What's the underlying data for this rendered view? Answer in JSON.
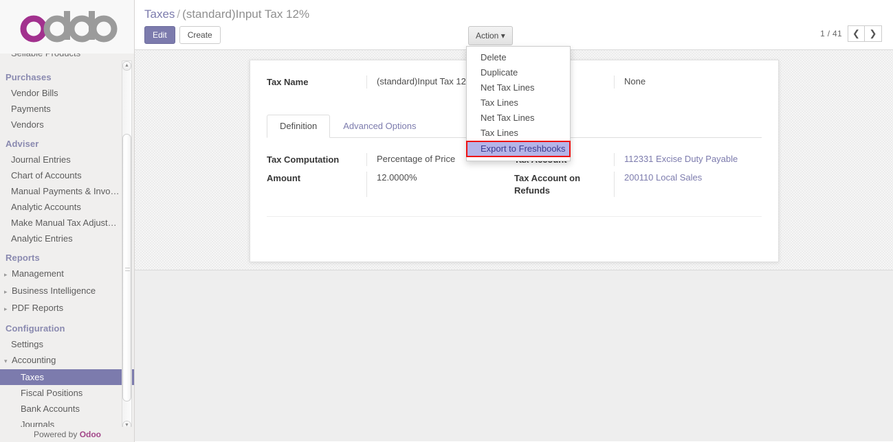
{
  "brand": {
    "logo_text": "odoo",
    "powered_by_prefix": "Powered by ",
    "powered_by_brand": "Odoo"
  },
  "sidebar": {
    "clipped_top_item": "Sellable Products",
    "sections": [
      {
        "title": "Purchases",
        "items": [
          {
            "label": "Vendor Bills",
            "active": false,
            "caret": ""
          },
          {
            "label": "Payments",
            "active": false,
            "caret": ""
          },
          {
            "label": "Vendors",
            "active": false,
            "caret": ""
          }
        ]
      },
      {
        "title": "Adviser",
        "items": [
          {
            "label": "Journal Entries",
            "active": false,
            "caret": ""
          },
          {
            "label": "Chart of Accounts",
            "active": false,
            "caret": ""
          },
          {
            "label": "Manual Payments & Invo…",
            "active": false,
            "caret": ""
          },
          {
            "label": "Analytic Accounts",
            "active": false,
            "caret": ""
          },
          {
            "label": "Make Manual Tax Adjust…",
            "active": false,
            "caret": ""
          },
          {
            "label": "Analytic Entries",
            "active": false,
            "caret": ""
          }
        ]
      },
      {
        "title": "Reports",
        "items": [
          {
            "label": "Management",
            "active": false,
            "caret": "▸"
          },
          {
            "label": "Business Intelligence",
            "active": false,
            "caret": "▸"
          },
          {
            "label": "PDF Reports",
            "active": false,
            "caret": "▸"
          }
        ]
      },
      {
        "title": "Configuration",
        "items": [
          {
            "label": "Settings",
            "active": false,
            "caret": ""
          },
          {
            "label": "Accounting",
            "active": false,
            "caret": "▾"
          },
          {
            "label": "Taxes",
            "active": true,
            "caret": "",
            "sub": true
          },
          {
            "label": "Fiscal Positions",
            "active": false,
            "caret": "",
            "sub": true
          },
          {
            "label": "Bank Accounts",
            "active": false,
            "caret": "",
            "sub": true
          },
          {
            "label": "Journals",
            "active": false,
            "caret": "",
            "sub": true
          }
        ]
      }
    ]
  },
  "control_panel": {
    "breadcrumb_root": "Taxes",
    "breadcrumb_sep": "/",
    "breadcrumb_current": "(standard)Input Tax 12%",
    "edit_label": "Edit",
    "create_label": "Create",
    "action_label": "Action",
    "action_caret": "▾",
    "pager_text": "1 / 41",
    "pager_prev": "❮",
    "pager_next": "❯"
  },
  "action_menu": {
    "items": [
      {
        "label": "Delete",
        "highlighted": false
      },
      {
        "label": "Duplicate",
        "highlighted": false
      },
      {
        "label": "Net Tax Lines",
        "highlighted": false
      },
      {
        "label": "Tax Lines",
        "highlighted": false
      },
      {
        "label": "Net Tax Lines",
        "highlighted": false
      },
      {
        "label": "Tax Lines",
        "highlighted": false
      },
      {
        "label": "Export to Freshbooks",
        "highlighted": true
      }
    ]
  },
  "form": {
    "header_left": {
      "label": "Tax Name",
      "value": "(standard)Input Tax 12%"
    },
    "header_right": {
      "label": "",
      "value": "None"
    },
    "tabs": [
      {
        "label": "Definition",
        "active": true
      },
      {
        "label": "Advanced Options",
        "active": false
      }
    ],
    "definition_left": [
      {
        "label": "Tax Computation",
        "value": "Percentage of Price"
      },
      {
        "label": "Amount",
        "value": "12.0000%"
      }
    ],
    "definition_right": [
      {
        "label": "Tax Account",
        "value": "112331 Excise Duty Payable",
        "link": true
      },
      {
        "label": "Tax Account on Refunds",
        "value": "200110 Local Sales",
        "link": true
      }
    ]
  },
  "colors": {
    "accent": "#7c7bad",
    "highlight_bg": "#b5b4e8",
    "highlight_border": "#ee1111",
    "logo_magenta": "#a24689",
    "logo_gray": "#9b9b9b"
  }
}
